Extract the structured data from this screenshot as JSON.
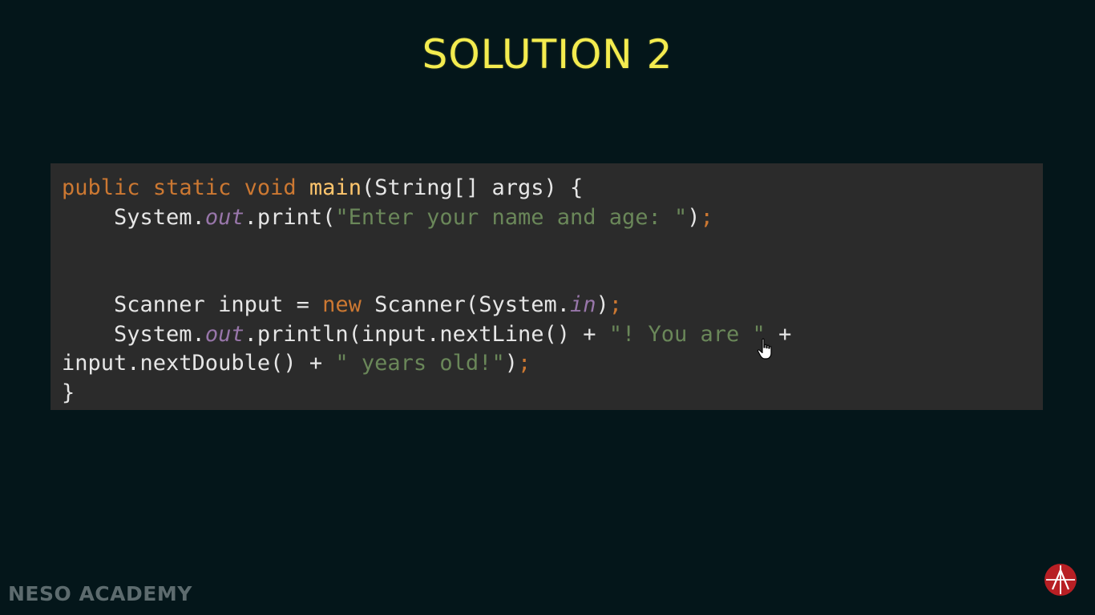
{
  "slide": {
    "title": "SOLUTION 2"
  },
  "code": {
    "lines": [
      [
        {
          "t": "public",
          "c": "kw"
        },
        {
          "t": " ",
          "c": ""
        },
        {
          "t": "static",
          "c": "kw"
        },
        {
          "t": " ",
          "c": ""
        },
        {
          "t": "void",
          "c": "kw"
        },
        {
          "t": " ",
          "c": ""
        },
        {
          "t": "main",
          "c": "fn"
        },
        {
          "t": "(String[] args) {",
          "c": ""
        }
      ],
      [
        {
          "t": "    System.",
          "c": ""
        },
        {
          "t": "out",
          "c": "fld"
        },
        {
          "t": ".print(",
          "c": ""
        },
        {
          "t": "\"Enter your name and age: \"",
          "c": "str"
        },
        {
          "t": ")",
          "c": ""
        },
        {
          "t": ";",
          "c": "semi"
        }
      ],
      [],
      [],
      [
        {
          "t": "    Scanner input = ",
          "c": ""
        },
        {
          "t": "new",
          "c": "kw"
        },
        {
          "t": " Scanner(System.",
          "c": ""
        },
        {
          "t": "in",
          "c": "fld"
        },
        {
          "t": ")",
          "c": ""
        },
        {
          "t": ";",
          "c": "semi"
        }
      ],
      [
        {
          "t": "    System.",
          "c": ""
        },
        {
          "t": "out",
          "c": "fld"
        },
        {
          "t": ".println(input.nextLine() + ",
          "c": ""
        },
        {
          "t": "\"! You are \"",
          "c": "str"
        },
        {
          "t": " +",
          "c": ""
        }
      ],
      [
        {
          "t": "input.nextDouble() + ",
          "c": ""
        },
        {
          "t": "\" years old!\"",
          "c": "str"
        },
        {
          "t": ")",
          "c": ""
        },
        {
          "t": ";",
          "c": "semi"
        }
      ],
      [
        {
          "t": "}",
          "c": ""
        }
      ]
    ]
  },
  "branding": {
    "name": "NESO ACADEMY",
    "logo_icon": "neso-academy-logo-icon"
  },
  "colors": {
    "background": "#04161a",
    "code_background": "#2b2b2b",
    "title": "#f4ec4f",
    "keyword": "#cc7832",
    "string": "#6a8759",
    "static_field": "#9876aa",
    "method_name": "#ffc66d",
    "plain_text": "#e6e6e6",
    "logo_red": "#b81f24"
  }
}
